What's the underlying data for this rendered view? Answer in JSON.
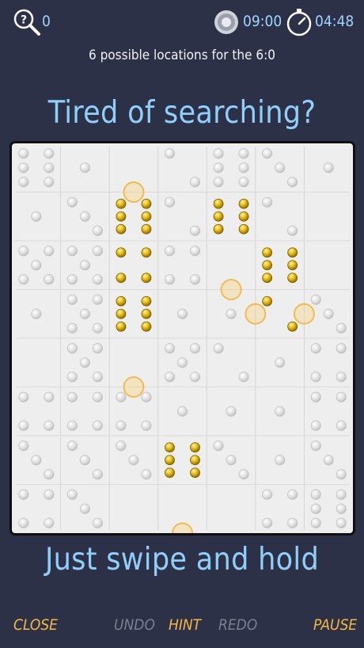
{
  "topbar": {
    "hint_count": "0",
    "target_time": "09:00",
    "elapsed_time": "04:48"
  },
  "info": "6 possible locations for the 6:0",
  "headline_top": "Tired of searching?",
  "headline_bottom": "Just swipe and hold",
  "bottombar": {
    "close": "CLOSE",
    "undo": "UNDO",
    "hint": "HINT",
    "redo": "REDO",
    "pause": "PAUSE"
  },
  "colors": {
    "background": "#2d3148",
    "accent_blue": "#8fd0fb",
    "accent_gold": "#f4b940",
    "disabled": "#7b7f90",
    "board": "#eeeeee",
    "pip_highlight": "#e6b800"
  },
  "board": {
    "columns": 7,
    "rows": 8,
    "cells": [
      [
        6,
        1,
        0,
        2,
        6,
        3,
        1
      ],
      [
        1,
        3,
        6,
        2,
        6,
        2,
        0
      ],
      [
        5,
        5,
        4,
        4,
        0,
        6,
        0
      ],
      [
        1,
        5,
        6,
        1,
        1,
        2,
        3
      ],
      [
        0,
        5,
        0,
        5,
        2,
        1,
        4
      ],
      [
        4,
        4,
        4,
        1,
        1,
        1,
        4
      ],
      [
        3,
        3,
        3,
        6,
        3,
        1,
        3
      ],
      [
        4,
        3,
        0,
        0,
        0,
        4,
        6
      ]
    ],
    "highlighted_cells": [
      [
        1,
        2
      ],
      [
        2,
        2
      ],
      [
        1,
        4
      ],
      [
        2,
        4
      ],
      [
        2,
        5
      ],
      [
        3,
        5
      ],
      [
        3,
        2
      ],
      [
        4,
        2
      ],
      [
        6,
        3
      ],
      [
        7,
        3
      ]
    ],
    "circle_markers": [
      [
        1,
        2,
        "top"
      ],
      [
        2,
        4,
        "bottom"
      ],
      [
        3,
        5,
        "left"
      ],
      [
        3,
        5,
        "right"
      ],
      [
        4,
        2,
        "bottom"
      ],
      [
        7,
        3,
        "bottom"
      ]
    ]
  }
}
